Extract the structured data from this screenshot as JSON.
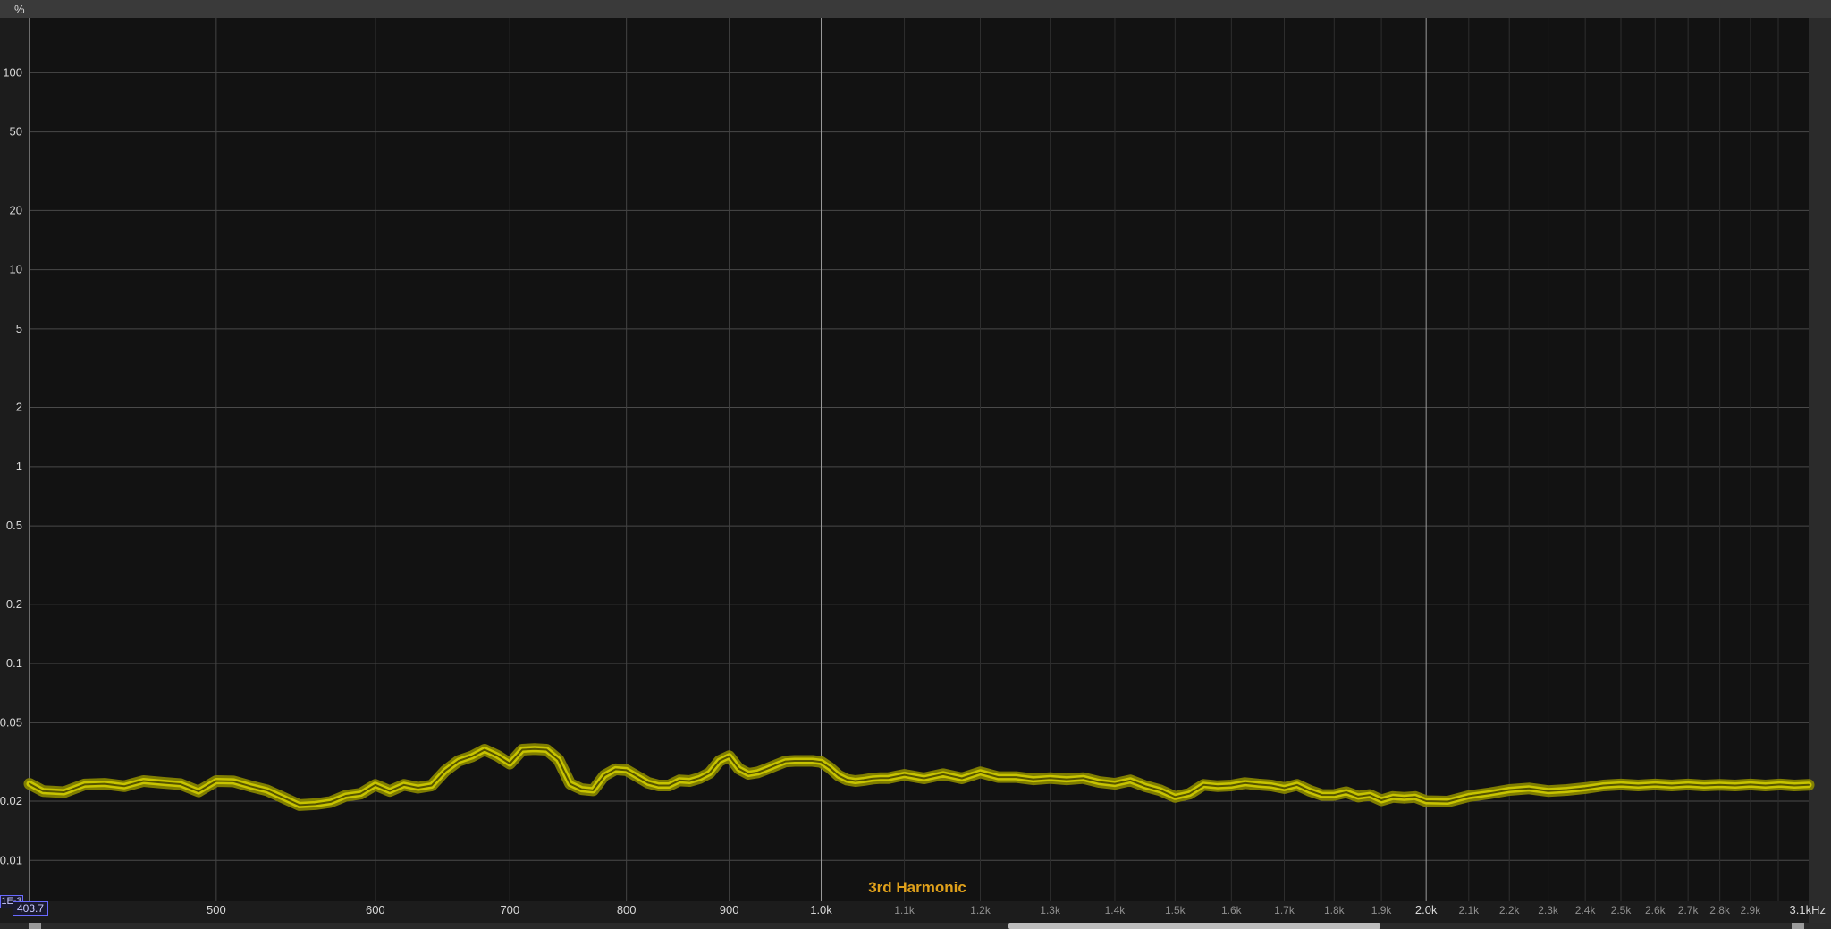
{
  "chart_data": {
    "type": "line",
    "title": "",
    "ylabel": "%",
    "xlabel": "",
    "y_scale": "log",
    "x_scale": "log",
    "xlim": [
      403.7,
      3100
    ],
    "ylim": [
      0.0062,
      190
    ],
    "start_value_label": "403.7",
    "range_label": "1E-3",
    "grid": true,
    "y_ticks": [
      {
        "value": 100,
        "label": "100"
      },
      {
        "value": 50,
        "label": "50"
      },
      {
        "value": 20,
        "label": "20"
      },
      {
        "value": 10,
        "label": "10"
      },
      {
        "value": 5,
        "label": "5"
      },
      {
        "value": 2,
        "label": "2"
      },
      {
        "value": 1,
        "label": "1"
      },
      {
        "value": 0.5,
        "label": "0.5"
      },
      {
        "value": 0.2,
        "label": "0.2"
      },
      {
        "value": 0.1,
        "label": "0.1"
      },
      {
        "value": 0.05,
        "label": "0.05"
      },
      {
        "value": 0.02,
        "label": "0.02"
      },
      {
        "value": 0.01,
        "label": "0.01"
      }
    ],
    "x_ticks_major": [
      {
        "value": 500,
        "label": "500"
      },
      {
        "value": 600,
        "label": "600"
      },
      {
        "value": 700,
        "label": "700"
      },
      {
        "value": 800,
        "label": "800"
      },
      {
        "value": 900,
        "label": "900"
      },
      {
        "value": 1000,
        "label": "1.0k"
      },
      {
        "value": 2000,
        "label": "2.0k"
      }
    ],
    "x_ticks_minor": [
      {
        "value": 1100,
        "label": "1.1k"
      },
      {
        "value": 1200,
        "label": "1.2k"
      },
      {
        "value": 1300,
        "label": "1.3k"
      },
      {
        "value": 1400,
        "label": "1.4k"
      },
      {
        "value": 1500,
        "label": "1.5k"
      },
      {
        "value": 1600,
        "label": "1.6k"
      },
      {
        "value": 1700,
        "label": "1.7k"
      },
      {
        "value": 1800,
        "label": "1.8k"
      },
      {
        "value": 1900,
        "label": "1.9k"
      },
      {
        "value": 2100,
        "label": "2.1k"
      },
      {
        "value": 2200,
        "label": "2.2k"
      },
      {
        "value": 2300,
        "label": "2.3k"
      },
      {
        "value": 2400,
        "label": "2.4k"
      },
      {
        "value": 2500,
        "label": "2.5k"
      },
      {
        "value": 2600,
        "label": "2.6k"
      },
      {
        "value": 2700,
        "label": "2.7k"
      },
      {
        "value": 2800,
        "label": "2.8k"
      },
      {
        "value": 2900,
        "label": "2.9k"
      }
    ],
    "x_end_label": "3.1kHz",
    "series": [
      {
        "name": "3rd Harmonic",
        "color": "#c8c400",
        "label_color": "#e0a11b",
        "x": [
          403.7,
          410,
          420,
          430,
          440,
          450,
          460,
          470,
          480,
          490,
          500,
          510,
          520,
          530,
          540,
          550,
          560,
          570,
          580,
          590,
          600,
          610,
          620,
          630,
          640,
          650,
          660,
          670,
          680,
          690,
          700,
          710,
          720,
          730,
          740,
          750,
          760,
          770,
          780,
          790,
          800,
          810,
          820,
          830,
          840,
          850,
          860,
          870,
          880,
          890,
          900,
          910,
          920,
          930,
          940,
          950,
          960,
          970,
          980,
          990,
          1000,
          1010,
          1020,
          1030,
          1040,
          1050,
          1060,
          1070,
          1080,
          1090,
          1100,
          1125,
          1150,
          1175,
          1200,
          1225,
          1250,
          1275,
          1300,
          1325,
          1350,
          1375,
          1400,
          1425,
          1450,
          1475,
          1500,
          1525,
          1550,
          1575,
          1600,
          1625,
          1650,
          1675,
          1700,
          1725,
          1750,
          1775,
          1800,
          1825,
          1850,
          1875,
          1900,
          1925,
          1950,
          1975,
          2000,
          2050,
          2100,
          2150,
          2200,
          2250,
          2300,
          2350,
          2400,
          2450,
          2500,
          2550,
          2600,
          2650,
          2700,
          2750,
          2800,
          2850,
          2900,
          2950,
          3000,
          3050,
          3100
        ],
        "y": [
          0.0245,
          0.0225,
          0.0222,
          0.0243,
          0.0245,
          0.0238,
          0.0253,
          0.0248,
          0.0244,
          0.0224,
          0.0253,
          0.0252,
          0.0238,
          0.0227,
          0.0208,
          0.0191,
          0.0193,
          0.0198,
          0.0213,
          0.0218,
          0.0242,
          0.0225,
          0.0242,
          0.0234,
          0.024,
          0.0285,
          0.032,
          0.0337,
          0.0365,
          0.034,
          0.031,
          0.0365,
          0.0368,
          0.0365,
          0.0325,
          0.0245,
          0.023,
          0.0227,
          0.027,
          0.029,
          0.0287,
          0.0267,
          0.0248,
          0.024,
          0.024,
          0.0255,
          0.0253,
          0.0262,
          0.0278,
          0.032,
          0.0338,
          0.0292,
          0.0275,
          0.028,
          0.0292,
          0.0305,
          0.0318,
          0.032,
          0.032,
          0.032,
          0.0316,
          0.0295,
          0.027,
          0.0257,
          0.0253,
          0.0256,
          0.026,
          0.0262,
          0.0262,
          0.0267,
          0.0272,
          0.0261,
          0.0274,
          0.0261,
          0.028,
          0.0265,
          0.0265,
          0.0258,
          0.0262,
          0.0258,
          0.0262,
          0.025,
          0.0245,
          0.0255,
          0.0238,
          0.0227,
          0.021,
          0.0218,
          0.0242,
          0.0238,
          0.024,
          0.0247,
          0.0243,
          0.024,
          0.0233,
          0.0242,
          0.0226,
          0.0215,
          0.0215,
          0.0222,
          0.0211,
          0.0215,
          0.0202,
          0.021,
          0.0208,
          0.021,
          0.02,
          0.0199,
          0.0212,
          0.0219,
          0.0228,
          0.0232,
          0.0225,
          0.0228,
          0.0233,
          0.024,
          0.0243,
          0.024,
          0.0243,
          0.024,
          0.0243,
          0.024,
          0.0242,
          0.024,
          0.0243,
          0.024,
          0.0243,
          0.024,
          0.0242
        ]
      }
    ]
  }
}
